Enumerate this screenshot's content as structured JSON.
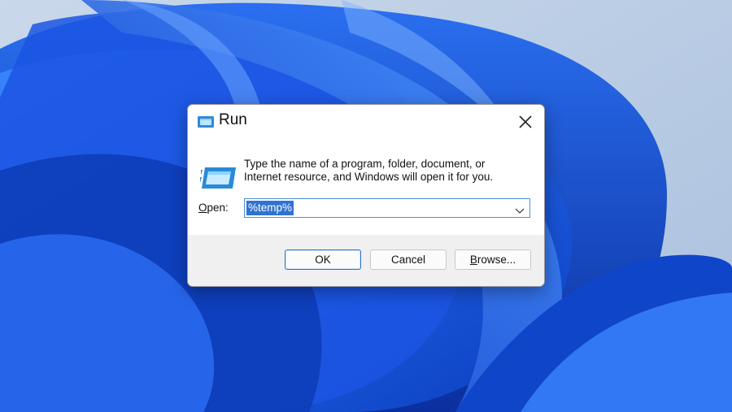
{
  "dialog": {
    "title": "Run",
    "description_line1": "Type the name of a program, folder, document, or",
    "description_line2": "Internet resource, and Windows will open it for you.",
    "open_label_accel": "O",
    "open_label_rest": "pen:",
    "open_value": "%temp%",
    "buttons": {
      "ok": "OK",
      "cancel": "Cancel",
      "browse_accel": "B",
      "browse_rest": "rowse..."
    }
  },
  "icons": {
    "title": "run-icon",
    "main": "run-icon",
    "close": "close-icon",
    "dropdown": "chevron-down-icon"
  },
  "colors": {
    "selection": "#2f73d0",
    "focus_border": "#4b8fd8",
    "wallpaper_blue": "#1f5bdc"
  }
}
